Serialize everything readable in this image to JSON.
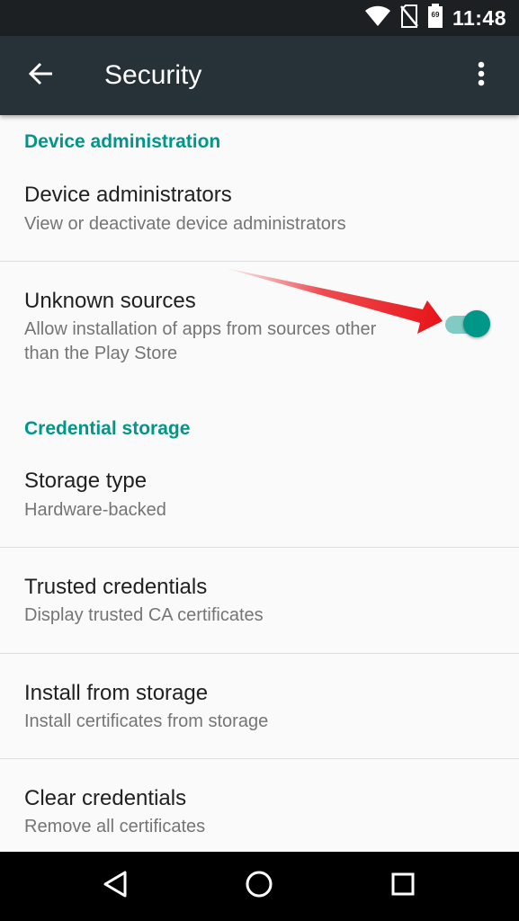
{
  "status_bar": {
    "time": "11:48",
    "battery_level": "69",
    "icons": [
      "wifi-icon",
      "no-sim-icon",
      "battery-icon"
    ]
  },
  "app_bar": {
    "title": "Security",
    "back_icon": "arrow-back-icon",
    "menu_icon": "more-vert-icon"
  },
  "sections": [
    {
      "header": "Device administration",
      "items": [
        {
          "title": "Device administrators",
          "subtitle": "View or deactivate device administrators"
        },
        {
          "title": "Unknown sources",
          "subtitle": "Allow installation of apps from sources other than the Play Store",
          "toggle": true
        }
      ]
    },
    {
      "header": "Credential storage",
      "items": [
        {
          "title": "Storage type",
          "subtitle": "Hardware-backed"
        },
        {
          "title": "Trusted credentials",
          "subtitle": "Display trusted CA certificates"
        },
        {
          "title": "Install from storage",
          "subtitle": "Install certificates from storage"
        },
        {
          "title": "Clear credentials",
          "subtitle": "Remove all certificates"
        }
      ]
    }
  ],
  "nav_bar": {
    "buttons": [
      "back-triangle-icon",
      "home-circle-icon",
      "recents-square-icon"
    ]
  },
  "colors": {
    "accent": "#009688",
    "app_bar": "#263238",
    "status_bar": "#1c2023",
    "annotation_arrow": "#e8141a"
  }
}
